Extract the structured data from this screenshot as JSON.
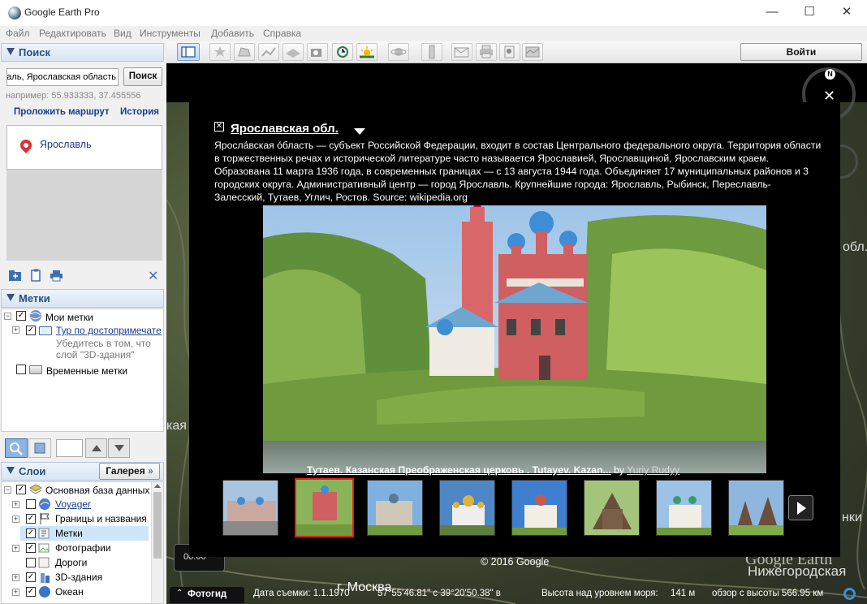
{
  "window": {
    "title": "Google Earth Pro",
    "minimize": "—",
    "maximize": "☐",
    "close": "✕"
  },
  "menu": [
    "Файл",
    "Редактировать",
    "Вид",
    "Инструменты",
    "Добавить",
    "Справка"
  ],
  "search": {
    "heading": "Поиск",
    "input_value": "аль, Ярославская область",
    "button": "Поиск",
    "example": "например: 55.933333, 37.455556",
    "route_link": "Проложить маршрут",
    "history_link": "История",
    "result": "Ярославль"
  },
  "places": {
    "heading": "Метки",
    "my_places": "Мои метки",
    "tour": "Тур по достопримечате",
    "tour_note1": "Убедитесь в том, что",
    "tour_note2": "слой \"3D-здания\"",
    "temp": "Временные метки"
  },
  "layers": {
    "heading": "Слои",
    "gallery": "Галерея",
    "items": [
      {
        "label": "Основная база данных",
        "checked": true
      },
      {
        "label": "Voyager",
        "checked": false
      },
      {
        "label": "Границы и названия",
        "checked": true
      },
      {
        "label": "Метки",
        "checked": true
      },
      {
        "label": "Фотографии",
        "checked": true
      },
      {
        "label": "Дороги",
        "checked": false
      },
      {
        "label": "3D-здания",
        "checked": true
      },
      {
        "label": "Океан",
        "checked": true
      }
    ]
  },
  "toolbar": {
    "signin": "Войти"
  },
  "balloon": {
    "title": "Ярославская обл.",
    "description": "Яросла́вская о́бласть — субъект Российской Федерации, входит в состав Центрального федерального округа. Территория области в торжественных речах и исторической литературе часто называется Ярославией, Ярославщиной, Ярославским краем. Образована 11 марта 1936 года, в современных границах — с 13 августа 1944 года. Объединяет 17 муниципальных районов и 3 городских округа. Административный центр — город Ярославль. Крупнейшие города: Ярославль, Рыбинск, Переславль-Залесский, Тутаев, Углич, Ростов. Source: wikipedia.org",
    "caption": "Тутаев. Казанская Преображенская церковь . Tutayev. Kazan...",
    "by": "by",
    "author": "Yuriy Rudyy"
  },
  "map": {
    "compass_n": "N",
    "timer": "00:06",
    "copyright": "© 2016 Google",
    "logo": "Google Earth",
    "label_nizhny": "Нижегородская",
    "label_moscow": "г. Москва",
    "label_obl": "обл.",
    "label_kaya": "кая",
    "label_nki": "нки"
  },
  "status": {
    "photoguide": "Фотогид",
    "date": "Дата съемки: 1.1.1970",
    "coords": "57°55'46.81\" с  39°20'50.38\" в",
    "elevation": "Высота над уровнем моря:",
    "elevation_val": "141 м",
    "eye": "обзор с высоты  566.95 км"
  }
}
